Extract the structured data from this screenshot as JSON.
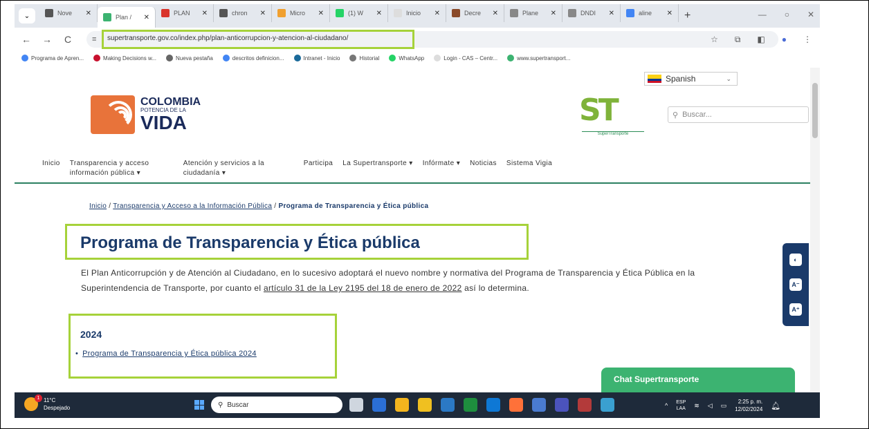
{
  "browser": {
    "tabs": [
      {
        "label": "Nove",
        "color": "#555555"
      },
      {
        "label": "Plan /",
        "color": "#3cb371",
        "active": true
      },
      {
        "label": "PLAN",
        "color": "#d9342b"
      },
      {
        "label": "chron",
        "color": "#555555"
      },
      {
        "label": "Micro",
        "color": "#f0a030"
      },
      {
        "label": "(1) W",
        "color": "#25d366"
      },
      {
        "label": "Inicio",
        "color": "#dddddd"
      },
      {
        "label": "Decre",
        "color": "#8a4a2a"
      },
      {
        "label": "Plane",
        "color": "#888888"
      },
      {
        "label": "DNDI",
        "color": "#888888"
      },
      {
        "label": "aline",
        "color": "#4285f4"
      }
    ],
    "tab_close": "✕",
    "new_tab": "+",
    "url": "supertransporte.gov.co/index.php/plan-anticorrupcion-y-atencion-al-ciudadano/",
    "bookmarks": [
      {
        "label": "Programa de Apren...",
        "color": "#4285f4"
      },
      {
        "label": "Making Decisions w...",
        "color": "#c8102e"
      },
      {
        "label": "Nueva pestaña",
        "color": "#666666"
      },
      {
        "label": "descritos definicion...",
        "color": "#4285f4"
      },
      {
        "label": "Intranet - Inicio",
        "color": "#1a6a9a"
      },
      {
        "label": "Historial",
        "color": "#777777"
      },
      {
        "label": "WhatsApp",
        "color": "#25d366"
      },
      {
        "label": "Login - CAS – Centr...",
        "color": "#dddddd"
      },
      {
        "label": "www.supertransport...",
        "color": "#3cb371"
      }
    ]
  },
  "header": {
    "language": "Spanish",
    "logo_line1": "COLOMBIA",
    "logo_line2": "POTENCIA DE LA",
    "logo_line3": "VIDA",
    "st_letters": "ST",
    "st_sub": "SuperTransporte",
    "search_placeholder": "Buscar..."
  },
  "menu": [
    "Inicio",
    "Transparencia y acceso información pública ▾",
    "Atención y servicios a la ciudadanía ▾",
    "Participa",
    "La Supertransporte ▾",
    "Infórmate ▾",
    "Noticias",
    "Sistema Vigia"
  ],
  "breadcrumb": {
    "home": "Inicio",
    "sep": "/",
    "parent": "Transparencia y Acceso a la Información Pública",
    "current": "Programa de Transparencia y Ética pública"
  },
  "content": {
    "title": "Programa de Transparencia y Ética pública",
    "intro_before": "El Plan Anticorrupción y de Atención al Ciudadano, en lo sucesivo adoptará el nuevo nombre y normativa del Programa de Transparencia y Ética Pública en la Superintendencia de Transporte, por cuanto el ",
    "intro_link": "artículo 31 de la Ley 2195 del 18 de enero de 2022",
    "intro_after": " así lo determina.",
    "year": "2024",
    "bullet": "•",
    "year_link": "Programa de Transparencia y Ética pública 2024"
  },
  "accessibility": [
    "◐",
    "A⁻",
    "A⁺"
  ],
  "chat": "Chat Supertransporte",
  "taskbar": {
    "temp": "11°C",
    "condition": "Despejado",
    "badge": "1",
    "search": "Buscar",
    "lang1": "ESP",
    "lang2": "LAA",
    "time": "2:25 p. m.",
    "date": "12/02/2024",
    "app_colors": [
      "#cfd6df",
      "#2b6fd6",
      "#f3b51e",
      "#f0c020",
      "#2b79c5",
      "#1e8e3e",
      "#0e78d5",
      "#ff7139",
      "#4a7bd0",
      "#4b53bc",
      "#b33a3a",
      "#3aa0d0"
    ]
  }
}
